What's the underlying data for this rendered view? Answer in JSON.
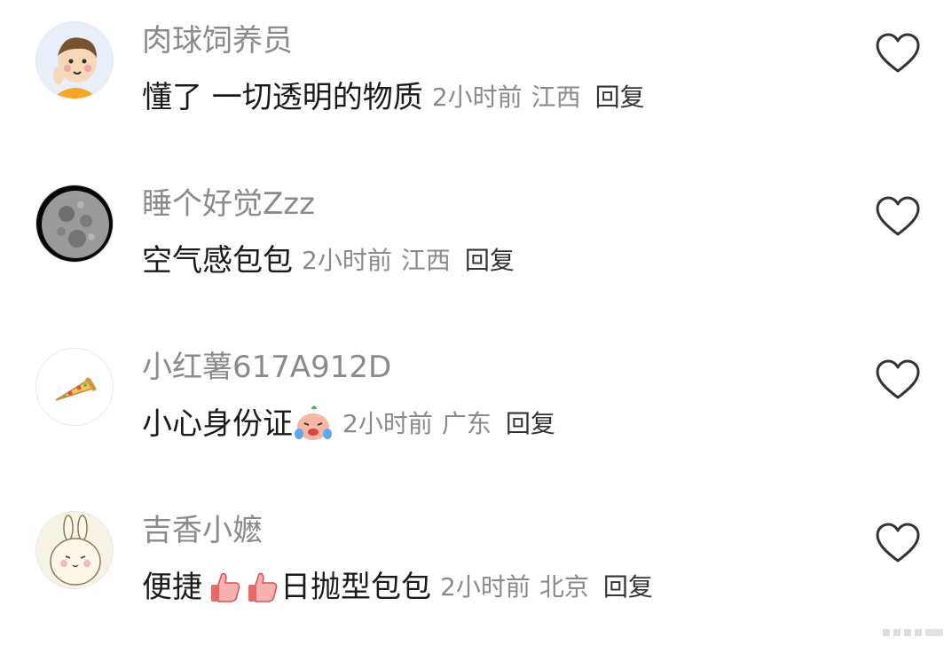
{
  "comments": [
    {
      "username": "肉球饲养员",
      "text": "懂了 一切透明的物质",
      "time": "2小时前",
      "region": "江西",
      "reply": "回复",
      "avatar": "cartoon-boy-avatar"
    },
    {
      "username": "睡个好觉Zzz",
      "text": "空气感包包",
      "time": "2小时前",
      "region": "江西",
      "reply": "回复",
      "avatar": "moon-avatar"
    },
    {
      "username": "小红薯617A912D",
      "text": "小心身份证",
      "time": "2小时前",
      "region": "广东",
      "reply": "回复",
      "avatar": "pizza-avatar",
      "emoji": "crying-emoji"
    },
    {
      "username": "吉香小嬷",
      "text_before": "便捷",
      "text_after": "日抛型包包",
      "time": "2小时前",
      "region": "北京",
      "reply": "回复",
      "avatar": "bunny-avatar",
      "emoji": "thumbs-up-emoji"
    }
  ],
  "colors": {
    "username": "#8a8a8a",
    "text": "#1a1a1a",
    "meta": "#8a8a8a",
    "reply": "#333333",
    "heart_outline": "#333333"
  },
  "icons": [
    "heart-outline-icon"
  ]
}
